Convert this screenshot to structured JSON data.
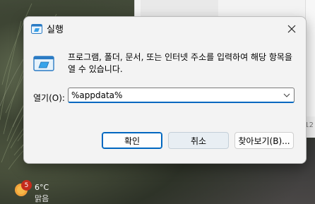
{
  "dialog": {
    "title": "실행",
    "description": "프로그램, 폴더, 문서, 또는 인터넷 주소를 입력하여 해당 항목을 열 수 있습니다.",
    "open_label": "열기(O):",
    "open_value": "%appdata%",
    "buttons": {
      "ok": "확인",
      "cancel": "취소",
      "browse": "찾아보기(B)..."
    }
  },
  "taskbar": {
    "weather": {
      "badge": "5",
      "temperature": "6°C",
      "condition": "맑음"
    }
  },
  "background_window": {
    "edge_text": "12"
  },
  "colors": {
    "accent": "#0067c0",
    "dialog_bg": "#f3f3f3",
    "badge": "#c42b1c"
  },
  "icons": [
    "run-app-icon",
    "close-icon",
    "run-program-icon",
    "chevron-down-icon",
    "weather-sun-icon"
  ]
}
